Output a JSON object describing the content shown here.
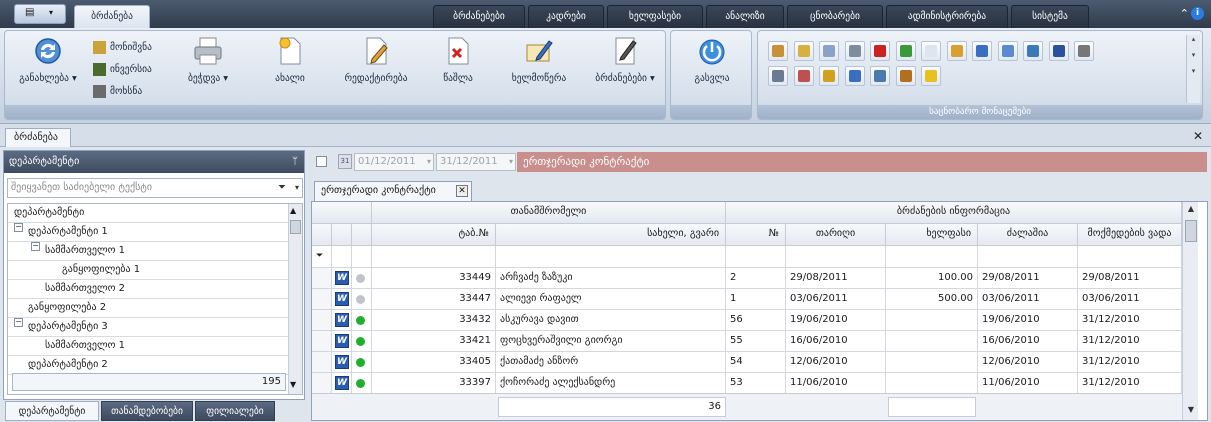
{
  "ribbon_tabs": [
    {
      "label": "ბრძანება",
      "active": true
    },
    {
      "label": "ბრძანებები"
    },
    {
      "label": "კადრები"
    },
    {
      "label": "ხელფასები"
    },
    {
      "label": "ანალიზი"
    },
    {
      "label": "ცნობარები"
    },
    {
      "label": "ადმინისტრირება"
    },
    {
      "label": "სისტემა"
    }
  ],
  "ribbon": {
    "refresh_label": "განახლება",
    "small_buttons": [
      "მონიშვნა",
      "ინვერსია",
      "მოხსნა"
    ],
    "print_label": "ბეჭდვა",
    "new_label": "ახალი",
    "edit_label": "რედაქტირება",
    "delete_label": "წაშლა",
    "sign_label": "ხელმოწერა",
    "orders_label": "ბრძანებები",
    "exit_label": "გასვლა",
    "reference_group_label": "საცნობარო მონაცემები"
  },
  "doc_tab": "ბრძანება",
  "left_panel": {
    "title": "დეპარტამენტი",
    "search_placeholder": "შეიყვანეთ საძიებელი ტექსტი",
    "tree": [
      {
        "label": "დეპარტამენტი",
        "level": 0
      },
      {
        "label": "დეპარტამენტი 1",
        "level": 1
      },
      {
        "label": "სამმართველო 1",
        "level": 2
      },
      {
        "label": "განყოფილება 1",
        "level": 3
      },
      {
        "label": "სამმართველო 2",
        "level": 2
      },
      {
        "label": "განყოფილება 2",
        "level": 1
      },
      {
        "label": "დეპარტამენტი 3",
        "level": 1
      },
      {
        "label": "სამმართველო 1",
        "level": 2
      },
      {
        "label": "დეპარტამენტი 2",
        "level": 1
      }
    ],
    "count": "195",
    "bottom_tabs": [
      "დეპარტამენტი",
      "თანამდებობები",
      "ფილიალები"
    ]
  },
  "filter": {
    "date_from": "01/12/2011",
    "date_to": "31/12/2011",
    "title": "ერთჯერადი კონტრაქტი"
  },
  "grid_tab": "ერთჯერადი კონტრაქტი",
  "grid": {
    "group_employee": "თანამშრომელი",
    "group_order": "ბრძანების ინფორმაცია",
    "columns": [
      "ტაბ.№",
      "სახელი, გვარი",
      "№",
      "თარიღი",
      "ხელფასი",
      "ძალაშია",
      "მოქმედების ვადა"
    ],
    "rows": [
      {
        "tab": "33449",
        "name": "არჩვაძე ზაზუკი",
        "no": "2",
        "date": "29/08/2011",
        "salary": "100.00",
        "valid": "29/08/2011",
        "until": "29/08/2011",
        "status": "gray"
      },
      {
        "tab": "33447",
        "name": "ალიევი რაფაელ",
        "no": "1",
        "date": "03/06/2011",
        "salary": "500.00",
        "valid": "03/06/2011",
        "until": "03/06/2011",
        "status": "gray"
      },
      {
        "tab": "33432",
        "name": "ასკურავა დავით",
        "no": "56",
        "date": "19/06/2010",
        "salary": "",
        "valid": "19/06/2010",
        "until": "31/12/2010",
        "status": "green"
      },
      {
        "tab": "33421",
        "name": "ფოცხვერაშვილი გიორგი",
        "no": "55",
        "date": "16/06/2010",
        "salary": "",
        "valid": "16/06/2010",
        "until": "31/12/2010",
        "status": "green"
      },
      {
        "tab": "33405",
        "name": "ქათამაძე ანზორ",
        "no": "54",
        "date": "12/06/2010",
        "salary": "",
        "valid": "12/06/2010",
        "until": "31/12/2010",
        "status": "green"
      },
      {
        "tab": "33397",
        "name": "ქოჩორაძე ალექსანდრე",
        "no": "53",
        "date": "11/06/2010",
        "salary": "",
        "valid": "11/06/2010",
        "until": "31/12/2010",
        "status": "green"
      }
    ],
    "footer_count": "36"
  },
  "colors": {
    "accent": "#c98f8d",
    "green": "#1fae2e",
    "gray": "#c0c4ca"
  }
}
